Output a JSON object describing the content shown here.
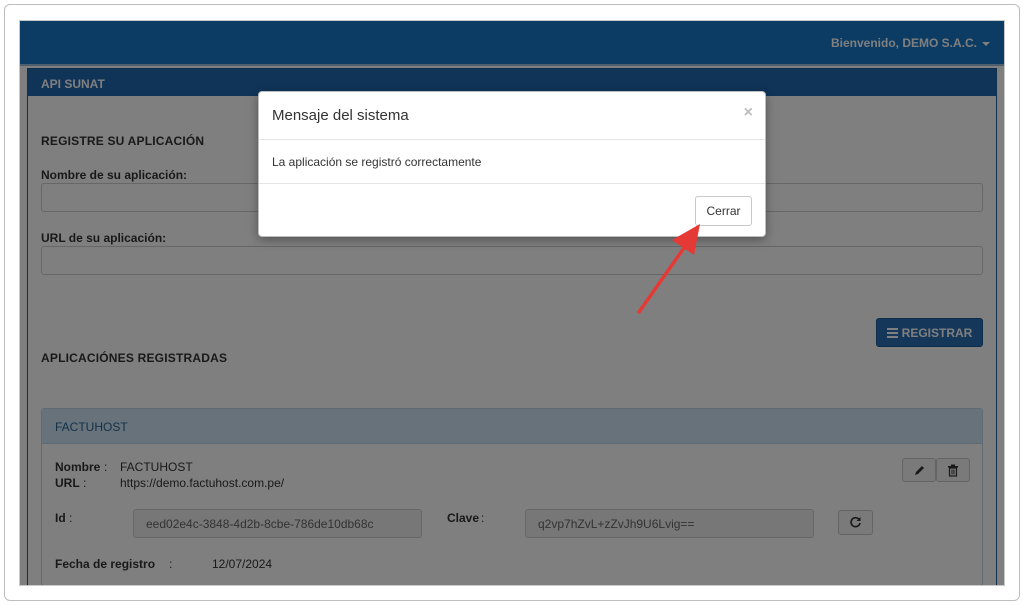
{
  "navbar": {
    "welcome_text": "Bienvenido, DEMO S.A.C."
  },
  "panel": {
    "title": "API SUNAT"
  },
  "form": {
    "section_title": "REGISTRE SU APLICACIÓN",
    "name_label": "Nombre de su aplicación:",
    "name_value": "",
    "url_label": "URL de su aplicación:",
    "url_value": "",
    "register_label": "REGISTRAR"
  },
  "registered": {
    "section_title": "APLICACIÓNES REGISTRADAS",
    "apps": [
      {
        "header": "FACTUHOST",
        "name_label": "Nombre",
        "name_value": "FACTUHOST",
        "url_label": "URL",
        "url_value": "https://demo.factuhost.com.pe/",
        "id_label": "Id",
        "id_value": "eed02e4c-3848-4d2b-8cbe-786de10db68c",
        "key_label": "Clave",
        "key_value": "q2vp7hZvL+zZvJh9U6Lvig==",
        "date_label": "Fecha de registro",
        "date_value": "12/07/2024"
      }
    ]
  },
  "modal": {
    "title": "Mensaje del sistema",
    "close_glyph": "×",
    "message": "La aplicación se registró correctamente",
    "close_button": "Cerrar"
  },
  "separators": {
    "colon": ":"
  },
  "icons": {
    "register": "list-icon",
    "edit": "pencil-icon",
    "delete": "trash-icon",
    "refresh": "refresh-icon",
    "annotation": "red-arrow"
  },
  "colors": {
    "navbar": "#1976c7",
    "panel_heading": "#1e68b0",
    "primary_button": "#2a6fb5",
    "annotation_arrow": "#e53935"
  }
}
